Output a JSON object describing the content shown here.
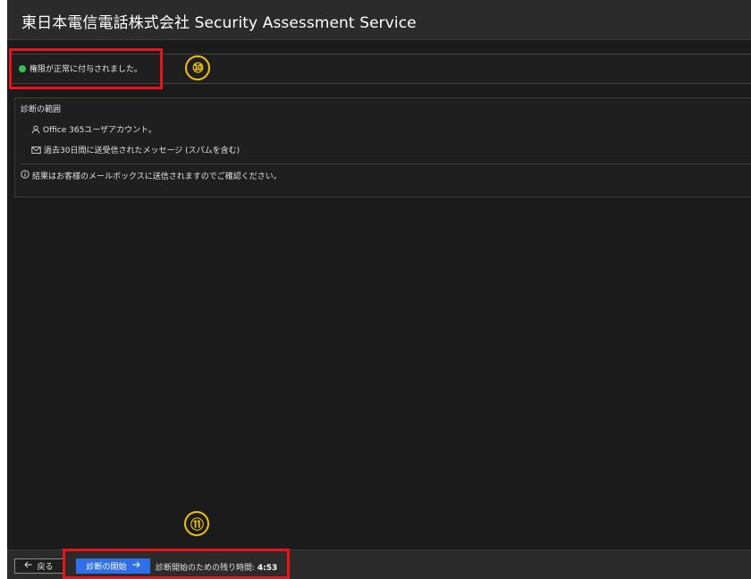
{
  "header": {
    "title": "東日本電信電話株式会社 Security Assessment Service"
  },
  "status": {
    "message": "権限が正常に付与されました。",
    "color": "#3cbf5a"
  },
  "scope": {
    "title": "診断の範囲",
    "items": [
      {
        "icon": "person-icon",
        "label": "Office 365ユーザアカウント。"
      },
      {
        "icon": "mail-icon",
        "label": "過去30日間に送受信されたメッセージ (スパムを含む)"
      }
    ],
    "note": {
      "icon": "info-icon",
      "label": "結果はお客様のメールボックスに送信されますのでご確認ください。"
    }
  },
  "footer": {
    "back_label": "戻る",
    "start_label": "診断の開始",
    "timer_label": "診断開始のための残り時間:",
    "timer_value": "4:53",
    "accent_color": "#2f6fe8"
  },
  "annotations": {
    "callout_10": "⑩",
    "callout_11": "⑪",
    "box_color": "#e8141a",
    "number_color": "#f2c200"
  }
}
